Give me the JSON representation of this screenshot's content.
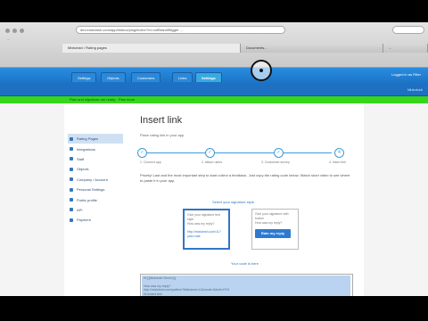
{
  "browser": {
    "address": "dev.mixkdnsh.com/app/#inbox/plog/index/?m=cofBrand/Bigger ...",
    "tabs": [
      "Mixkdnsh / Rating pages",
      "Documents...",
      "..."
    ],
    "bookmarks": "..."
  },
  "app": {
    "tabs": [
      "Settings",
      "Objects",
      "Customers",
      "Links",
      "Settings"
    ],
    "logged_in": "Logged in as Filter",
    "subbar_right": "Mixkdnsh",
    "green_notice": "Plan and signature are ready · Plan more"
  },
  "sidebar": {
    "items": [
      "Rating Pages",
      "Integrations",
      "Staff",
      "Objects",
      "Company / Account",
      "Personal Settings",
      "Public profile",
      "API",
      "Payment"
    ]
  },
  "main": {
    "title": "Insert link",
    "subtitle": "Place rating link in your app.",
    "steps": [
      "1. Connect app",
      "2. Attach users",
      "3. Customize survey",
      "4. Insert link"
    ],
    "step_numbers": [
      "✓",
      "✓",
      "✓",
      "4"
    ],
    "paragraph": "Priority! Last and the most important step to start collect a feedback. Just copy the rating code below. Watch short video to see where to paste it in your app.",
    "select_label": "Select your signature style",
    "card1": {
      "line1": "Give your signature text style",
      "line2": "How was my reply?",
      "link": "http://mixkdnsh.com/11?plan=rate"
    },
    "card2": {
      "line1": "Give your signature with button",
      "line2": "How was my reply?",
      "button": "Rate my reply"
    },
    "your_code": "Your code is here",
    "code_lines": [
      "Hi {{Mixkdnsh Sent to}}",
      "",
      "How was my reply?",
      "http://mixkdnsh.com/pattern?Mixkdnsh=11&mode=8&ref=HTH",
      "Hi ended text"
    ]
  }
}
